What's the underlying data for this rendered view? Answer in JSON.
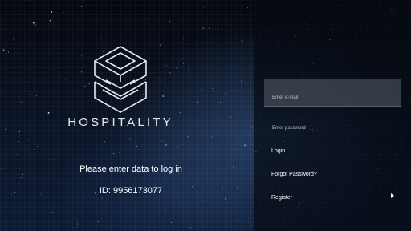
{
  "brand": {
    "name": "HOSPITALITY",
    "logo_icon": "isometric-cube-logo-icon"
  },
  "left": {
    "prompt": "Please enter data to log in",
    "device_id": "ID: 9956173077"
  },
  "form": {
    "email_placeholder": "Enter e-mail",
    "password_placeholder": "Enter password",
    "login_label": "Login",
    "forgot_label": "Forgot Password?",
    "register_label": "Register",
    "register_icon": "chevron-right-icon"
  },
  "colors": {
    "background": "#050a14",
    "panel": "#060a12",
    "input_fill": "#5a606c",
    "text": "#ffffff"
  }
}
